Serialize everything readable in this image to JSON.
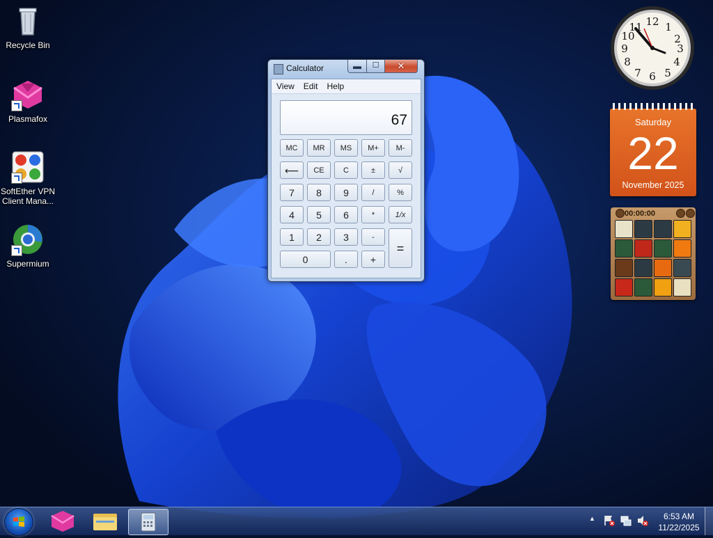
{
  "desktop": {
    "icons": [
      {
        "label": "Recycle Bin"
      },
      {
        "label": "Plasmafox"
      },
      {
        "label": "SoftEther VPN Client Mana..."
      },
      {
        "label": "Supermium"
      }
    ]
  },
  "calculator": {
    "title": "Calculator",
    "menu": [
      "View",
      "Edit",
      "Help"
    ],
    "display": "67",
    "memory_keys": [
      "MC",
      "MR",
      "MS",
      "M+",
      "M-"
    ],
    "row2": [
      "⟵",
      "CE",
      "C",
      "±",
      "√"
    ],
    "row3": [
      "7",
      "8",
      "9",
      "/",
      "%"
    ],
    "row4": [
      "4",
      "5",
      "6",
      "*",
      "1/x"
    ],
    "row5": [
      "1",
      "2",
      "3",
      "-"
    ],
    "row6": [
      "0",
      ".",
      "+"
    ],
    "equals": "="
  },
  "gadgets": {
    "calendar": {
      "day": "Saturday",
      "date": "22",
      "month_year": "November 2025"
    },
    "puzzle": {
      "timer": "00:00:00"
    }
  },
  "taskbar": {
    "time": "6:53 AM",
    "date": "11/22/2025",
    "show_hidden_icons": "▲"
  },
  "colors": {
    "calendar": "#e06a26",
    "taskbar": "#1c3a7a"
  }
}
